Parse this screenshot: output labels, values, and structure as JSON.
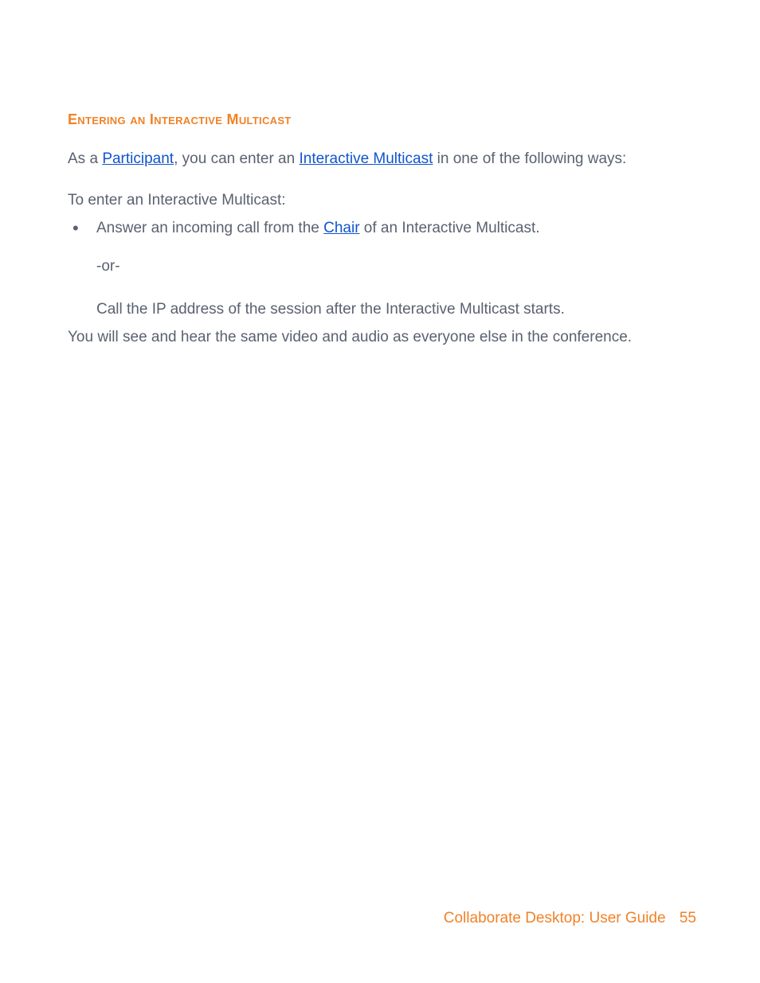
{
  "heading": "Entering an Interactive Multicast",
  "intro": {
    "pre": "As a ",
    "link1": "Participant",
    "mid": ", you can enter an ",
    "link2": "Interactive Multicast",
    "post": " in one of the following ways:"
  },
  "to_enter": "To enter an Interactive Multicast:",
  "bullet": {
    "pre": "Answer an incoming call from the ",
    "link": "Chair",
    "post": " of an Interactive Multicast."
  },
  "or_sep": "-or-",
  "call_line": "Call the IP address of the session after the Interactive Multicast starts.",
  "closing": "You will see and hear the same video and audio as everyone else in the conference.",
  "footer": {
    "title": "Collaborate Desktop: User Guide",
    "page": "55"
  }
}
